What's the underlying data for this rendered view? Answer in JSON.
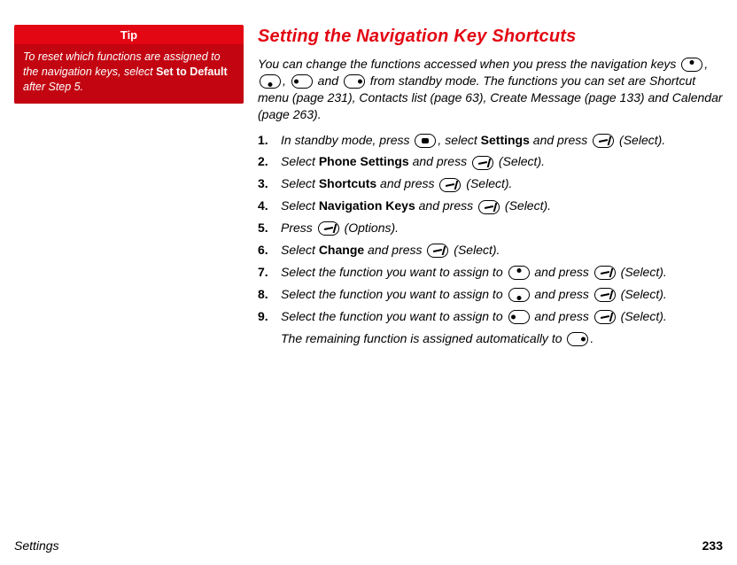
{
  "tip": {
    "title": "Tip",
    "body_parts": [
      "To reset which functions are assigned to the navigation keys, select ",
      "Set to Default",
      " after Step 5."
    ]
  },
  "heading": "Setting the Navigation Key Shortcuts",
  "intro_parts": [
    "You can change the functions accessed when you press the navigation keys ",
    ", ",
    ", ",
    " and ",
    " from standby mode. The functions you can set are Shortcut menu (page 231), Contacts list (page 63), Create Message (page 133) and Calendar (page 263)."
  ],
  "steps": {
    "s1": {
      "a": "In standby mode, press ",
      "b": ", select ",
      "bold1": "Settings",
      "c": " and press ",
      "d": " (Select)."
    },
    "s2": {
      "a": "Select ",
      "bold1": "Phone Settings",
      "b": " and press ",
      "c": " (Select)."
    },
    "s3": {
      "a": "Select ",
      "bold1": "Shortcuts",
      "b": " and press ",
      "c": " (Select)."
    },
    "s4": {
      "a": "Select ",
      "bold1": "Navigation Keys",
      "b": " and press ",
      "c": " (Select)."
    },
    "s5": {
      "a": "Press ",
      "b": " (Options)."
    },
    "s6": {
      "a": "Select ",
      "bold1": "Change",
      "b": " and press ",
      "c": " (Select)."
    },
    "s7": {
      "a": "Select the function you want to assign to ",
      "b": " and press ",
      "c": " (Select)."
    },
    "s8": {
      "a": "Select the function you want to assign to ",
      "b": " and press ",
      "c": " (Select)."
    },
    "s9": {
      "a": "Select the function you want to assign to ",
      "b": " and press ",
      "c": " (Select)."
    }
  },
  "note_parts": [
    "The remaining function is assigned automatically to ",
    "."
  ],
  "footer": {
    "section": "Settings",
    "page": "233"
  }
}
